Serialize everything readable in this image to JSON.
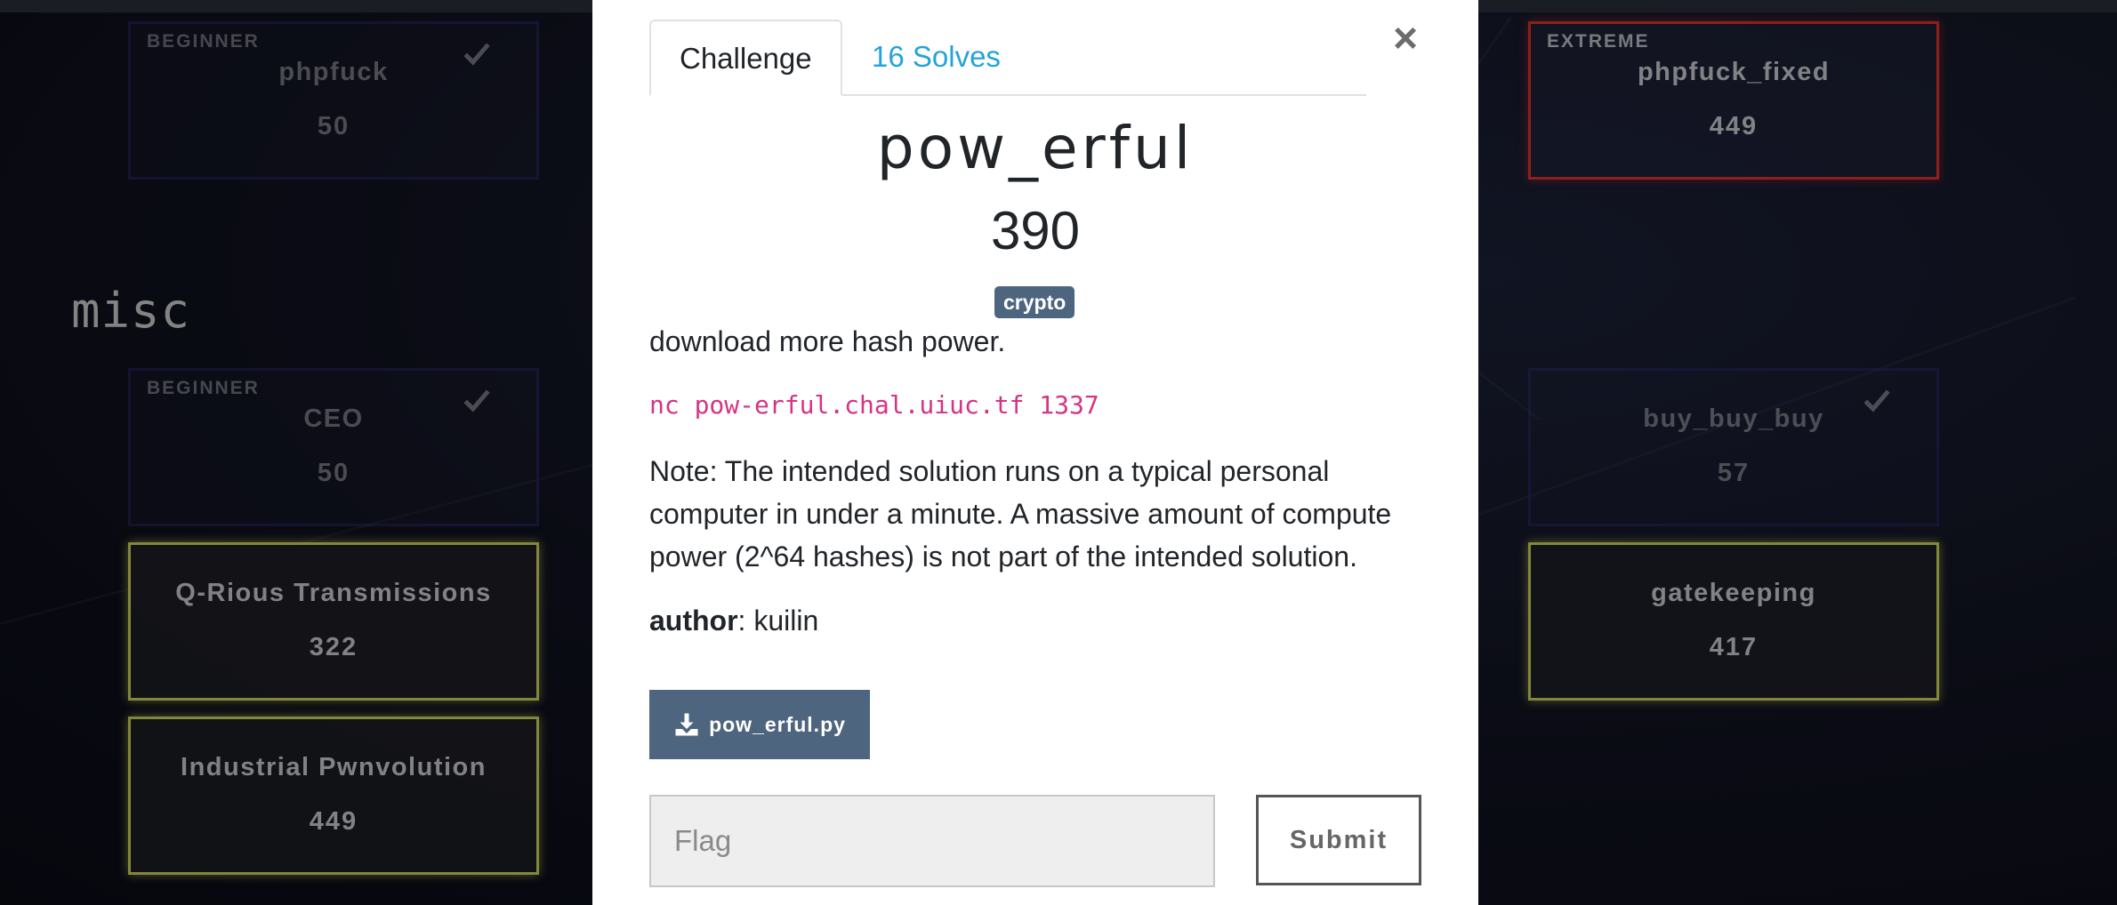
{
  "modal": {
    "tabs": [
      {
        "label": "Challenge"
      },
      {
        "label": "16 Solves"
      }
    ],
    "close_label": "×",
    "challenge_name": "pow_erful",
    "challenge_value": "390",
    "tag": "crypto",
    "description": [
      "download more hash power.",
      "nc pow-erful.chal.uiuc.tf 1337",
      "Note: The intended solution runs on a typical personal computer in under a minute. A massive amount of compute power (2^64 hashes) is not part of the intended solution."
    ],
    "author_label": "author",
    "author_value": ": kuilin",
    "file_label": "pow_erful.py",
    "flag_placeholder": "Flag",
    "submit_label": "Submit"
  },
  "board": {
    "category": "misc",
    "cards": [
      {
        "difficulty": "BEGINNER",
        "name": "phpfuck",
        "points": "50",
        "solved": true
      },
      {
        "difficulty": "EXTREME",
        "name": "phpfuck_fixed",
        "points": "449",
        "solved": false
      },
      {
        "difficulty": "BEGINNER",
        "name": "CEO",
        "points": "50",
        "solved": true
      },
      {
        "difficulty": "",
        "name": "buy_buy_buy",
        "points": "57",
        "solved": true
      },
      {
        "difficulty": "",
        "name": "Q-Rious Transmissions",
        "points": "322",
        "solved": false
      },
      {
        "difficulty": "",
        "name": "gatekeeping",
        "points": "417",
        "solved": false
      },
      {
        "difficulty": "",
        "name": "Industrial Pwnvolution",
        "points": "449",
        "solved": false
      }
    ]
  },
  "colors": {
    "accent_link": "#24a4d8",
    "tag_bg": "#4e6580",
    "code": "#d63384",
    "glow_card": "#c9cf5a",
    "extreme_card": "#d9312c"
  }
}
